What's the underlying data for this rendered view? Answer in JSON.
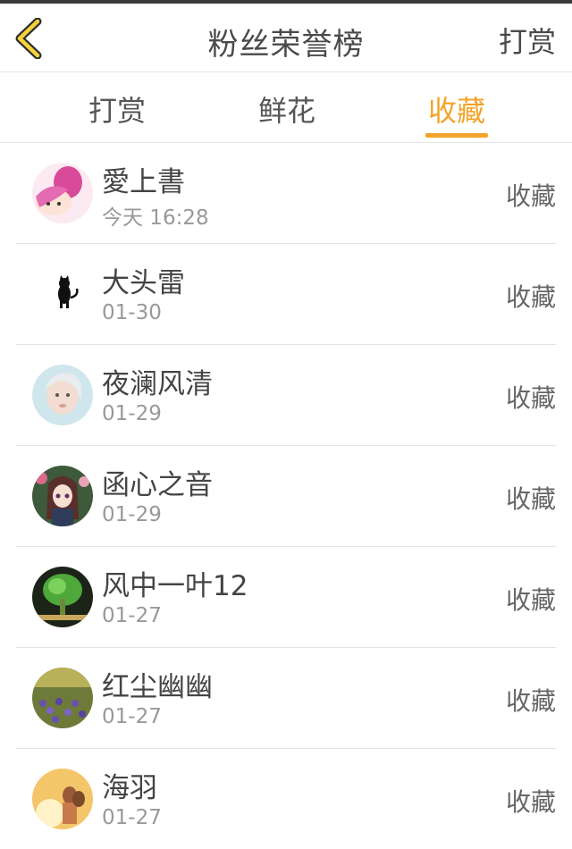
{
  "header": {
    "title": "粉丝荣誉榜",
    "right_label": "打赏"
  },
  "tabs": [
    {
      "label": "打赏",
      "active": false
    },
    {
      "label": "鲜花",
      "active": false
    },
    {
      "label": "收藏",
      "active": true
    }
  ],
  "colors": {
    "accent": "#f2a42a",
    "divider": "#e4e4e4",
    "text_primary": "#444444",
    "text_secondary": "#999999"
  },
  "icons": {
    "back": "chevron-left-icon"
  },
  "list": [
    {
      "name": "愛上書",
      "date": "今天 16:28",
      "action": "收藏",
      "avatar": "anime-pink-hair-avatar"
    },
    {
      "name": "大头雷",
      "date": "01-30",
      "action": "收藏",
      "avatar": "black-cat-avatar"
    },
    {
      "name": "夜澜风清",
      "date": "01-29",
      "action": "收藏",
      "avatar": "girl-portrait-avatar"
    },
    {
      "name": "函心之音",
      "date": "01-29",
      "action": "收藏",
      "avatar": "anime-girl-flowers-avatar"
    },
    {
      "name": "风中一叶12",
      "date": "01-27",
      "action": "收藏",
      "avatar": "green-plant-avatar"
    },
    {
      "name": "红尘幽幽",
      "date": "01-27",
      "action": "收藏",
      "avatar": "lavender-field-avatar"
    },
    {
      "name": "海羽",
      "date": "01-27",
      "action": "收藏",
      "avatar": "sunset-couple-avatar"
    }
  ]
}
